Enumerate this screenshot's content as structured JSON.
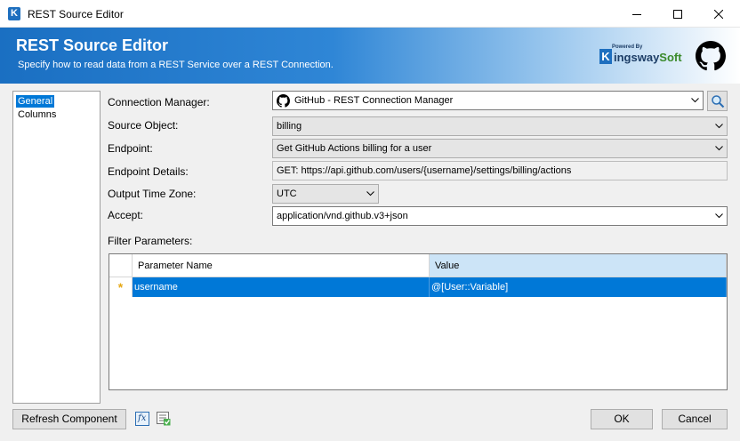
{
  "window": {
    "title": "REST Source Editor",
    "app_icon_letter": "K"
  },
  "banner": {
    "title": "REST Source Editor",
    "subtitle": "Specify how to read data from a REST Service over a REST Connection.",
    "vendor_powered": "Powered By",
    "vendor_k": "K",
    "vendor_name_part1": "ingsway",
    "vendor_name_part2": "Soft"
  },
  "nav": {
    "items": [
      {
        "label": "General",
        "selected": true
      },
      {
        "label": "Columns",
        "selected": false
      }
    ]
  },
  "form": {
    "connection_manager": {
      "label": "Connection Manager:",
      "value": "GitHub - REST Connection Manager"
    },
    "source_object": {
      "label": "Source Object:",
      "value": "billing"
    },
    "endpoint": {
      "label": "Endpoint:",
      "value": "Get GitHub Actions billing for a user"
    },
    "endpoint_details": {
      "label": "Endpoint Details:",
      "value": "GET: https://api.github.com/users/{username}/settings/billing/actions"
    },
    "output_time_zone": {
      "label": "Output Time Zone:",
      "value": "UTC"
    },
    "accept": {
      "label": "Accept:",
      "value": "application/vnd.github.v3+json"
    },
    "filter_parameters": {
      "label": "Filter Parameters:"
    }
  },
  "grid": {
    "columns": [
      "Parameter Name",
      "Value"
    ],
    "rows": [
      {
        "marker": "*",
        "name": "username",
        "value": "@[User::Variable]"
      }
    ]
  },
  "footer": {
    "refresh_label": "Refresh Component",
    "ok_label": "OK",
    "cancel_label": "Cancel",
    "fx_label": "fx"
  },
  "colors": {
    "accent": "#0078d7",
    "banner_start": "#1a6fc2",
    "header_active": "#cce4f7",
    "new_row_marker": "#e6a817"
  }
}
